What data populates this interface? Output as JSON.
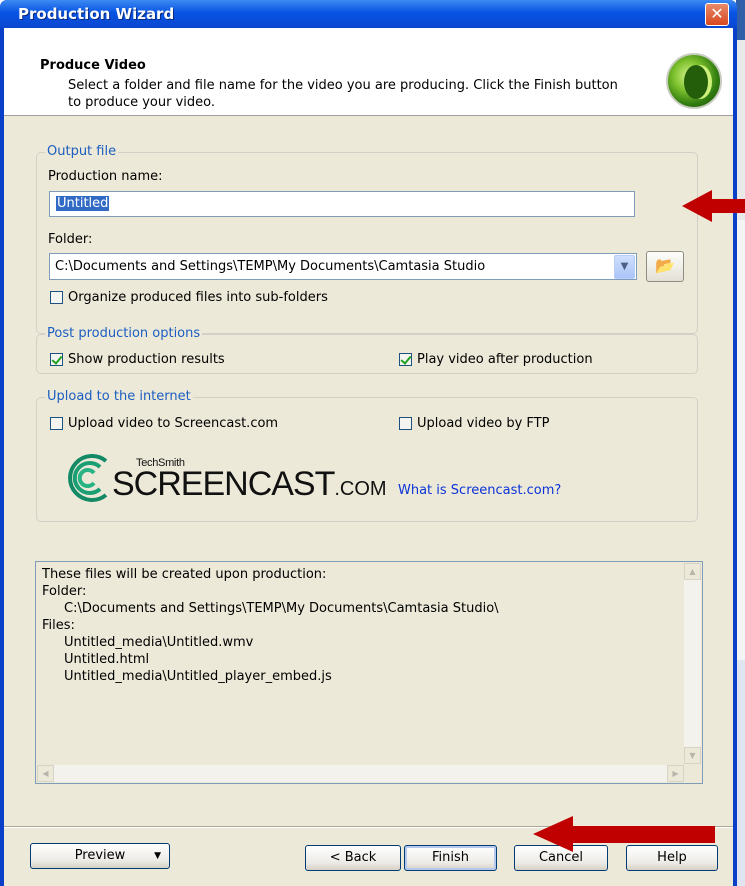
{
  "window": {
    "title": "Production Wizard",
    "close_glyph": "✕"
  },
  "header": {
    "title": "Produce Video",
    "description": "Select a folder and file name for the video you are producing.  Click the Finish button to produce your video.",
    "logo_icon": "camtasia-logo-icon"
  },
  "output_file": {
    "legend": "Output file",
    "production_name_label": "Production name:",
    "production_name_value": "Untitled",
    "folder_label": "Folder:",
    "folder_value": "C:\\Documents and Settings\\TEMP\\My Documents\\Camtasia Studio",
    "organize_label": "Organize produced files into sub-folders",
    "organize_checked": false
  },
  "post_production": {
    "legend": "Post production options",
    "show_results_label": "Show production results",
    "show_results_checked": true,
    "play_video_label": "Play video after production",
    "play_video_checked": true
  },
  "upload": {
    "legend": "Upload to the internet",
    "screencast_label": "Upload video to Screencast.com",
    "screencast_checked": false,
    "ftp_label": "Upload video by FTP",
    "ftp_checked": false,
    "logo_brand": "TechSmith",
    "logo_word": "SCREENCAST",
    "logo_suffix": ".COM",
    "what_is_link": "What is Screencast.com?"
  },
  "files_info": {
    "intro": "These files will be created upon production:",
    "folder_label": "Folder:",
    "folder_path": "C:\\Documents and Settings\\TEMP\\My Documents\\Camtasia Studio\\",
    "files_label": "Files:",
    "files": [
      "Untitled_media\\Untitled.wmv",
      "Untitled.html",
      "Untitled_media\\Untitled_player_embed.js"
    ]
  },
  "buttons": {
    "preview": "Preview",
    "back": "< Back",
    "finish": "Finish",
    "cancel": "Cancel",
    "help": "Help"
  },
  "colors": {
    "titlebar": "#0854e3",
    "dialog_bg": "#ece9d8",
    "legend_text": "#1c5ec2",
    "link": "#0b33d8",
    "annotation_arrow": "#c00000"
  }
}
